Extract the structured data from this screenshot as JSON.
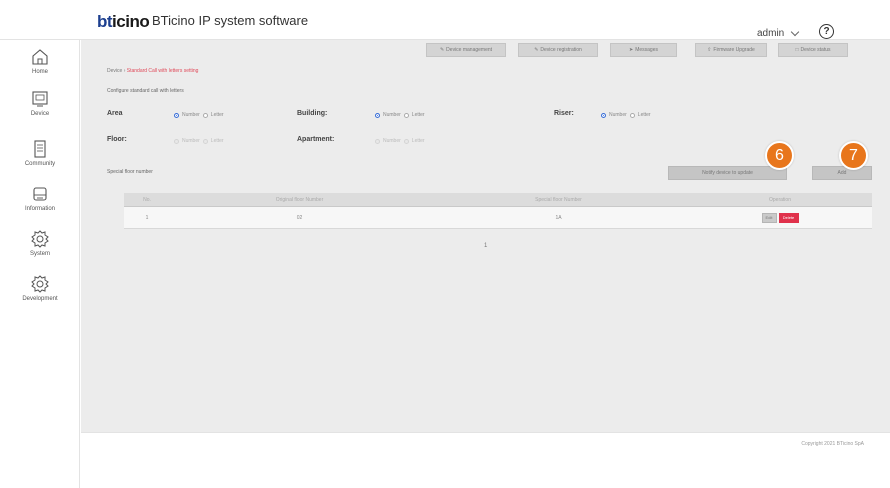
{
  "header": {
    "logo_text_b": "bt",
    "logo_text_rest": "icino",
    "app_title": "BTicino IP system software",
    "user": "admin",
    "help_symbol": "?"
  },
  "sidebar": {
    "items": [
      {
        "label": "Home",
        "icon": "home-icon"
      },
      {
        "label": "Device",
        "icon": "device-icon"
      },
      {
        "label": "Community",
        "icon": "community-icon"
      },
      {
        "label": "Information",
        "icon": "information-icon"
      },
      {
        "label": "System",
        "icon": "gear-icon"
      },
      {
        "label": "Development",
        "icon": "gear-icon"
      }
    ]
  },
  "topnav": {
    "items": [
      {
        "label": "Device management",
        "icon": "pencil-icon"
      },
      {
        "label": "Device registration",
        "icon": "pencil-icon"
      },
      {
        "label": "Messages",
        "icon": "send-icon"
      },
      {
        "label": "Firmware Upgrade",
        "icon": "upload-icon"
      },
      {
        "label": "Device status",
        "icon": "monitor-icon"
      }
    ]
  },
  "breadcrumb": {
    "root": "Device",
    "current": "Standard Call with letters setting"
  },
  "config": {
    "section_label": "Configure standard call with letters",
    "area_label": "Area",
    "building_label": "Building:",
    "riser_label": "Riser:",
    "floor_label": "Floor:",
    "apartment_label": "Apartment:",
    "opt_number": "Number",
    "opt_letter": "Letter"
  },
  "actions": {
    "notify_label": "Notify device to update",
    "add_label": "Add",
    "badge_notify": "6",
    "badge_add": "7"
  },
  "table": {
    "title": "Special floor number",
    "headers": [
      "No.",
      "Original floor Number",
      "Special floor Number",
      "Operation"
    ],
    "rows": [
      {
        "no": "1",
        "original": "02",
        "special": "1A",
        "edit": "Edit",
        "delete": "Delete"
      }
    ],
    "page": "1"
  },
  "footer": {
    "copyright": "Copyright 2021 BTicino SpA"
  },
  "colors": {
    "accent_badge": "#e8761c",
    "delete_red": "#e0314b",
    "radio_blue": "#3a6fd8",
    "link_red": "#e04a5a"
  }
}
